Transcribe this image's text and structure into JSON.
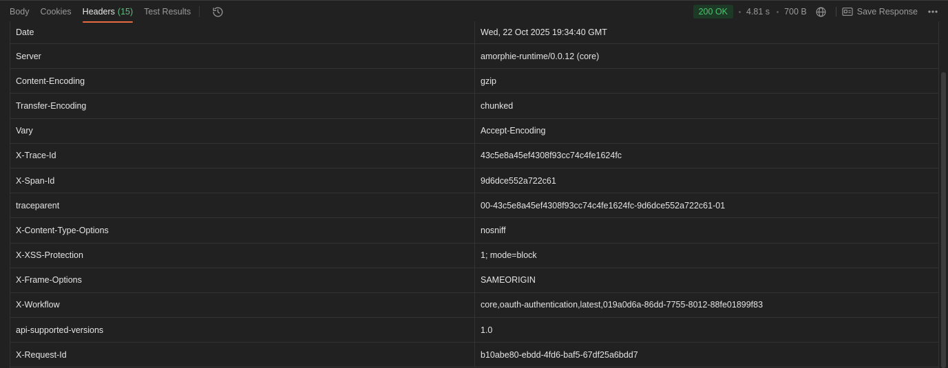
{
  "tabs": [
    {
      "label": "Body",
      "active": false
    },
    {
      "label": "Cookies",
      "active": false
    },
    {
      "label": "Headers",
      "count": "(15)",
      "active": true
    },
    {
      "label": "Test Results",
      "active": false
    }
  ],
  "response": {
    "status": "200 OK",
    "time": "4.81 s",
    "size": "700 B",
    "save_label": "Save Response"
  },
  "icons": {
    "history": "history-icon",
    "globe": "globe-icon",
    "save": "save-icon",
    "more": "more-horizontal-icon"
  },
  "colors": {
    "accent": "#e86a3f",
    "status_text": "#4fc46f",
    "status_bg": "#1d3a26",
    "count": "#5fbf7e"
  },
  "headers": [
    {
      "key": "Date",
      "value": "Wed, 22 Oct 2025 19:34:40 GMT"
    },
    {
      "key": "Server",
      "value": "amorphie-runtime/0.0.12 (core)"
    },
    {
      "key": "Content-Encoding",
      "value": "gzip"
    },
    {
      "key": "Transfer-Encoding",
      "value": "chunked"
    },
    {
      "key": "Vary",
      "value": "Accept-Encoding"
    },
    {
      "key": "X-Trace-Id",
      "value": "43c5e8a45ef4308f93cc74c4fe1624fc"
    },
    {
      "key": "X-Span-Id",
      "value": "9d6dce552a722c61"
    },
    {
      "key": "traceparent",
      "value": "00-43c5e8a45ef4308f93cc74c4fe1624fc-9d6dce552a722c61-01"
    },
    {
      "key": "X-Content-Type-Options",
      "value": "nosniff"
    },
    {
      "key": "X-XSS-Protection",
      "value": "1; mode=block"
    },
    {
      "key": "X-Frame-Options",
      "value": "SAMEORIGIN"
    },
    {
      "key": "X-Workflow",
      "value": "core,oauth-authentication,latest,019a0d6a-86dd-7755-8012-88fe01899f83"
    },
    {
      "key": "api-supported-versions",
      "value": "1.0"
    },
    {
      "key": "X-Request-Id",
      "value": "b10abe80-ebdd-4fd6-baf5-67df25a6bdd7"
    }
  ]
}
